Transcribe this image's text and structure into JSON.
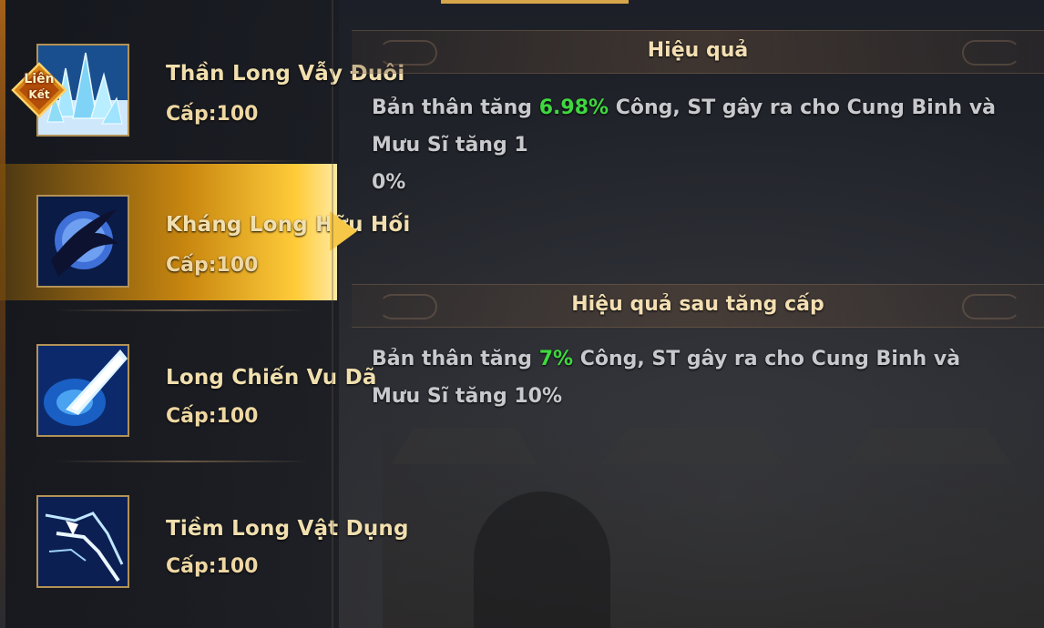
{
  "skills": [
    {
      "name": "Thần Long Vẫy Đuôi",
      "level": "Cấp:100",
      "icon": "ice-crystal-icon",
      "badge": [
        "Liên",
        "Kết"
      ]
    },
    {
      "name": "Kháng Long Hữu Hối",
      "level": "Cấp:100",
      "icon": "dragon-moon-icon",
      "active": true
    },
    {
      "name": "Long Chiến Vu Dã",
      "level": "Cấp:100",
      "icon": "energy-beam-icon"
    },
    {
      "name": "Tiềm Long Vật Dụng",
      "level": "Cấp:100",
      "icon": "lightning-spear-icon"
    }
  ],
  "effect": {
    "title": "Hiệu quả",
    "line1_pre": "Bản thân tăng ",
    "line1_value": "6.98%",
    "line1_post": " Công, ST gây ra cho Cung Binh và Mưu Sĩ tăng 1",
    "line2": "0%"
  },
  "upgrade": {
    "title": "Hiệu quả sau tăng cấp",
    "pre": "Bản thân tăng ",
    "value": "7%",
    "post": " Công, ST gây ra cho Cung Binh và Mưu Sĩ tăng 10%"
  },
  "colors": {
    "highlight": "#3fd83f",
    "gold": "#f1dfae",
    "active_row": "#c8860f"
  }
}
